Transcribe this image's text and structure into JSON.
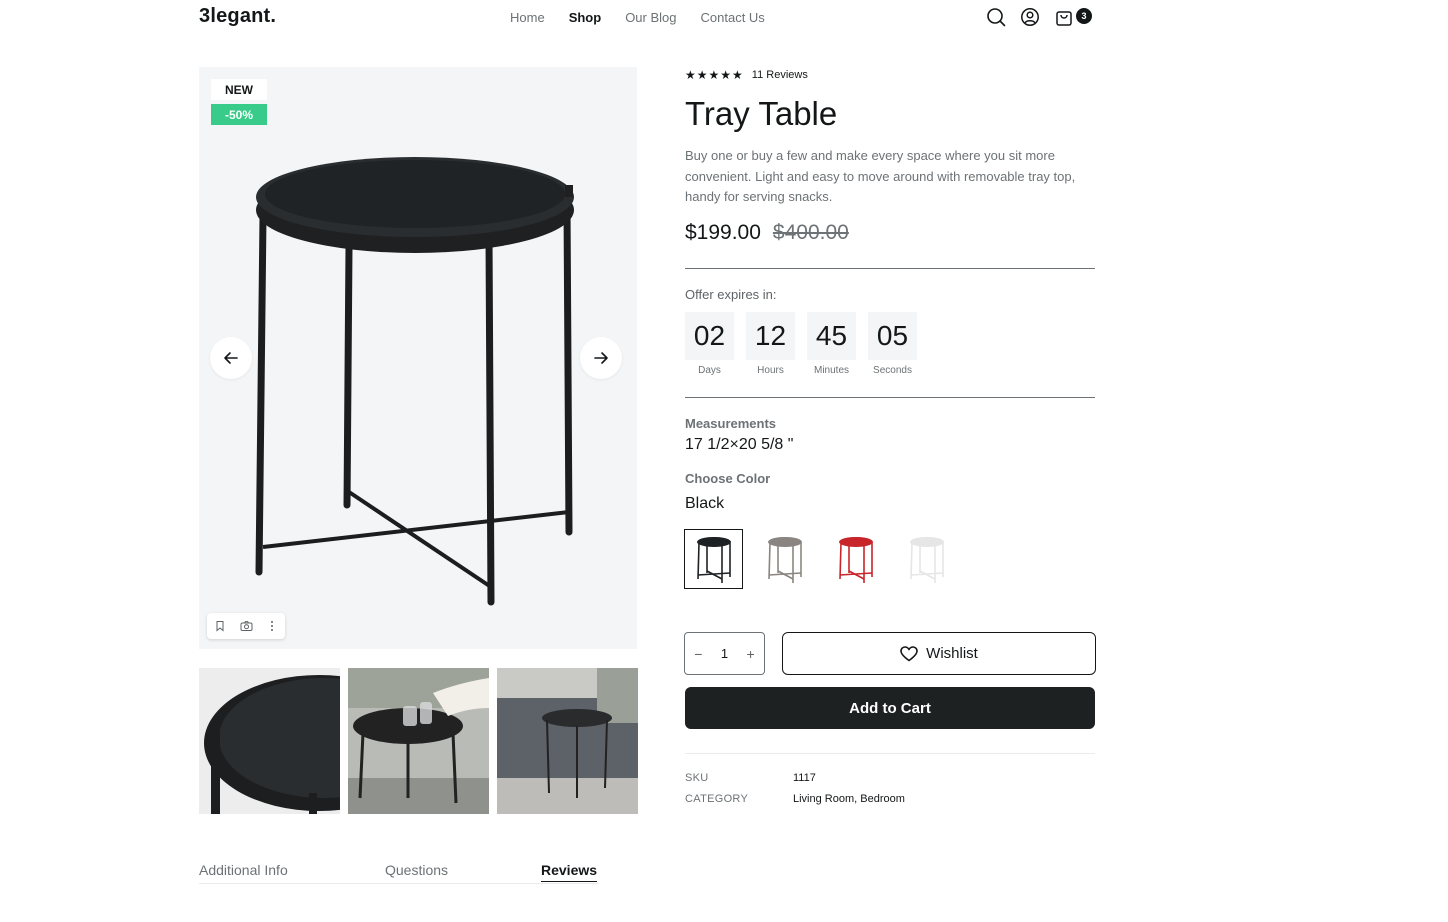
{
  "header": {
    "logo": "3legant.",
    "nav": [
      "Home",
      "Shop",
      "Our Blog",
      "Contact Us"
    ],
    "active_nav": "Shop",
    "cart_count": "3"
  },
  "gallery": {
    "badge_new": "NEW",
    "badge_discount": "-50%",
    "thumbnail_count": 3
  },
  "product": {
    "stars": "★★★★★",
    "reviews": "11 Reviews",
    "title": "Tray Table",
    "description": "Buy one or buy a few and make every space where you sit more convenient. Light and easy to move around with removable tray top, handy for serving snacks.",
    "price": "$199.00",
    "old_price": "$400.00"
  },
  "offer": {
    "label": "Offer expires in:",
    "timer": [
      {
        "value": "02",
        "label": "Days"
      },
      {
        "value": "12",
        "label": "Hours"
      },
      {
        "value": "45",
        "label": "Minutes"
      },
      {
        "value": "05",
        "label": "Seconds"
      }
    ]
  },
  "measurements": {
    "label": "Measurements",
    "value": "17 1/2×20 5/8 \""
  },
  "color": {
    "label": "Choose Color",
    "selected": "Black",
    "swatch_colors": [
      "#1f2224",
      "#8a8580",
      "#c8242b",
      "#e6e6e6"
    ]
  },
  "actions": {
    "quantity": "1",
    "wishlist": "Wishlist",
    "add_to_cart": "Add to Cart"
  },
  "meta": {
    "sku_label": "SKU",
    "sku": "1117",
    "category_label": "CATEGORY",
    "category": "Living Room, Bedroom"
  },
  "tabs": [
    "Additional Info",
    "Questions",
    "Reviews"
  ],
  "active_tab": "Reviews",
  "icons": [
    "search-icon",
    "user-icon",
    "bag-icon",
    "arrow-left-icon",
    "arrow-right-icon",
    "bookmark-icon",
    "camera-icon",
    "more-icon",
    "heart-icon",
    "minus-icon",
    "plus-icon"
  ]
}
